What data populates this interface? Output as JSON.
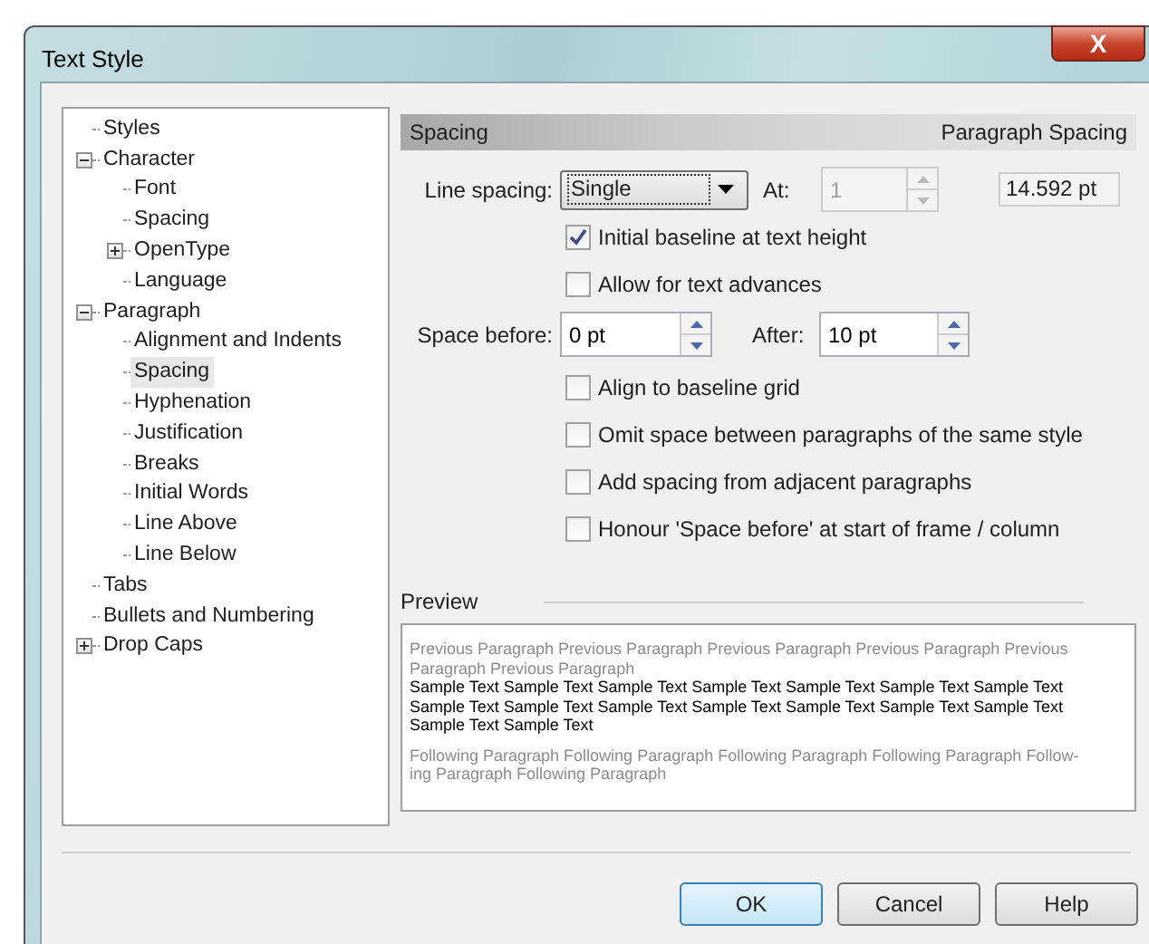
{
  "window": {
    "title": "Text Style",
    "close": "X"
  },
  "tree": [
    {
      "label": "Styles",
      "selected": false
    },
    {
      "label": "Character",
      "expanded": true,
      "selected": false,
      "children": [
        {
          "label": "Font",
          "selected": false
        },
        {
          "label": "Spacing",
          "selected": false
        },
        {
          "label": "OpenType",
          "expanded": false,
          "selected": false
        },
        {
          "label": "Language",
          "selected": false
        }
      ]
    },
    {
      "label": "Paragraph",
      "expanded": true,
      "selected": false,
      "children": [
        {
          "label": "Alignment and Indents",
          "selected": false
        },
        {
          "label": "Spacing",
          "selected": true
        },
        {
          "label": "Hyphenation",
          "selected": false
        },
        {
          "label": "Justification",
          "selected": false
        },
        {
          "label": "Breaks",
          "selected": false
        },
        {
          "label": "Initial Words",
          "selected": false
        },
        {
          "label": "Line Above",
          "selected": false
        },
        {
          "label": "Line Below",
          "selected": false
        }
      ]
    },
    {
      "label": "Tabs",
      "selected": false
    },
    {
      "label": "Bullets and Numbering",
      "selected": false
    },
    {
      "label": "Drop Caps",
      "expanded": false,
      "selected": false
    }
  ],
  "header": {
    "title": "Spacing",
    "subtitle": "Paragraph Spacing"
  },
  "line_spacing": {
    "label": "Line spacing:",
    "value": "Single",
    "at_label": "At:",
    "at_value": "1",
    "at_disabled": true,
    "result": "14.592 pt"
  },
  "checks_top": [
    {
      "label": "Initial baseline at text height",
      "checked": true
    },
    {
      "label": "Allow for text advances",
      "checked": false
    }
  ],
  "space": {
    "before_label": "Space before:",
    "before_value": "0 pt",
    "after_label": "After:",
    "after_value": "10 pt"
  },
  "checks_bottom": [
    {
      "label": "Align to baseline grid",
      "checked": false
    },
    {
      "label": "Omit space between paragraphs of the same style",
      "checked": false
    },
    {
      "label": "Add spacing from adjacent paragraphs",
      "checked": false
    },
    {
      "label": "Honour 'Space before' at start of frame / column",
      "checked": false
    }
  ],
  "preview": {
    "title": "Preview",
    "previous": [
      "Previous Paragraph Previous Paragraph Previous Paragraph Previous Paragraph Previous",
      "Paragraph Previous Paragraph"
    ],
    "sample": [
      "Sample Text Sample Text Sample Text Sample Text Sample Text Sample Text Sample Text",
      "Sample Text Sample Text Sample Text Sample Text Sample Text Sample Text Sample Text",
      "Sample Text Sample Text"
    ],
    "following": [
      "Following Paragraph Following Paragraph Following Paragraph Following Paragraph Follow-",
      "ing Paragraph Following Paragraph"
    ]
  },
  "buttons": [
    {
      "label": "OK",
      "default": true
    },
    {
      "label": "Cancel",
      "default": false
    },
    {
      "label": "Help",
      "default": false
    }
  ]
}
